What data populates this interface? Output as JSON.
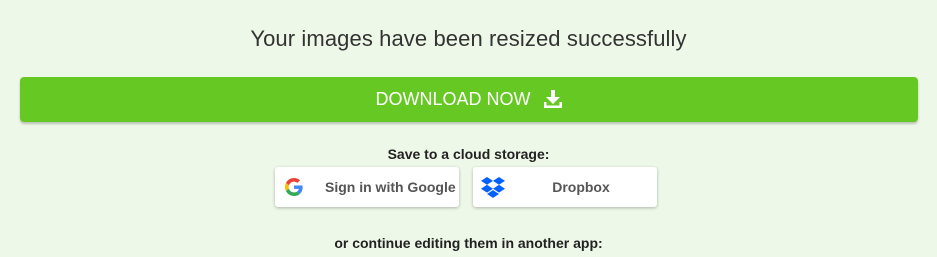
{
  "heading": "Your images have been resized successfully",
  "download": {
    "label": "DOWNLOAD NOW",
    "icon": "download-icon"
  },
  "cloud": {
    "label": "Save to a cloud storage:",
    "google": {
      "label": "Sign in with Google",
      "icon": "google-icon"
    },
    "dropbox": {
      "label": "Dropbox",
      "icon": "dropbox-icon"
    }
  },
  "continue_label": "or continue editing them in another app:",
  "colors": {
    "background": "#eef8e8",
    "download_button": "#66c823",
    "dropbox_blue": "#0061fe"
  }
}
